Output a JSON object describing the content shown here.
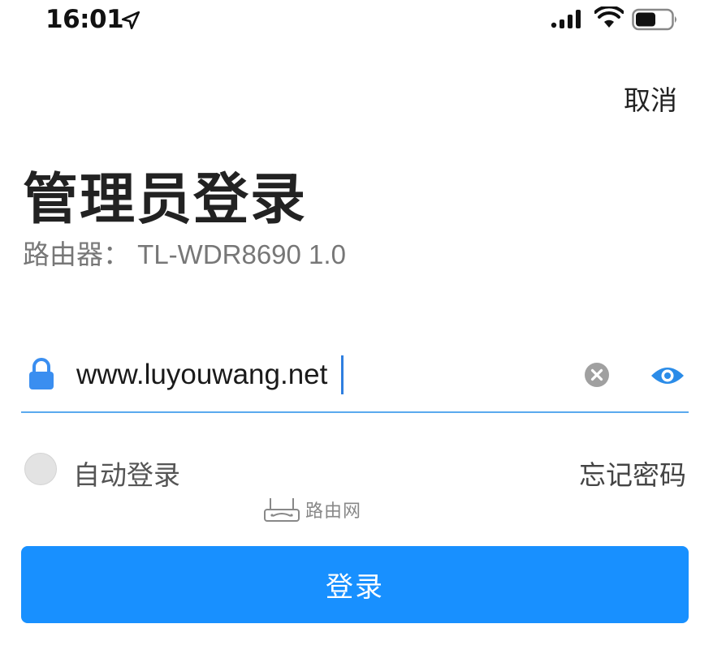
{
  "status_bar": {
    "time": "16:01",
    "icons": [
      "location-arrow-icon",
      "cellular-signal-icon",
      "wifi-icon",
      "battery-icon"
    ]
  },
  "header": {
    "cancel_label": "取消"
  },
  "login": {
    "title": "管理员登录",
    "subtitle": "路由器： TL-WDR8690 1.0",
    "password_value": "www.luyouwang.net",
    "auto_login_label": "自动登录",
    "auto_login_checked": false,
    "forgot_password_label": "忘记密码",
    "submit_label": "登录"
  },
  "watermark": {
    "text": "路由网",
    "icon": "router-icon"
  },
  "colors": {
    "accent": "#1890ff",
    "underline": "#5aa9ee",
    "lock_icon": "#3a8ef0",
    "eye_icon": "#2b8ce8",
    "clear_icon": "#a0a0a0"
  }
}
